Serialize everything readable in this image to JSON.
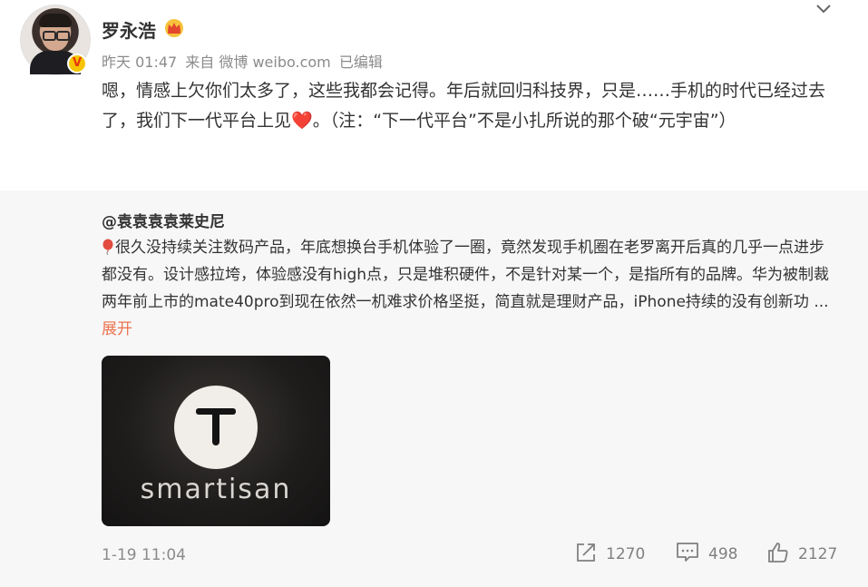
{
  "post": {
    "author": "罗永浩",
    "time": "昨天 01:47",
    "source": "来自 微博 weibo.com",
    "edited": "已编辑",
    "text_part1": "嗯，情感上欠你们太多了，这些我都会记得。年后就回归科技界，只是……手机的时代已经过去了，我们下一代平台上见",
    "heart": "❤️",
    "text_part2": "。（注：“下一代平台”不是小扎所说的那个破“元宇宙”）",
    "verified_badge": "V"
  },
  "repost": {
    "author": "@袁袁袁袁莱史尼",
    "text": "很久没持续关注数码产品，年底想换台手机体验了一圈，竟然发现手机圈在老罗离开后真的几乎一点进步都没有。设计感拉垮，体验感没有high点，只是堆积硬件，不是针对某一个，是指所有的品牌。华为被制裁两年前上市的mate40pro到现在依然一机难求价格坚挺，简直就是理财产品，iPhone持续的没有创新功",
    "ellipsis": " ... ",
    "expand_label": "展开",
    "image_wordmark": "smartisan",
    "time": "1-19 11:04"
  },
  "actions": {
    "repost_count": "1270",
    "comment_count": "498",
    "like_count": "2127"
  },
  "colors": {
    "link": "#eb7350",
    "meta": "#8b8b8b",
    "repost_bg": "#f7f7f7"
  }
}
